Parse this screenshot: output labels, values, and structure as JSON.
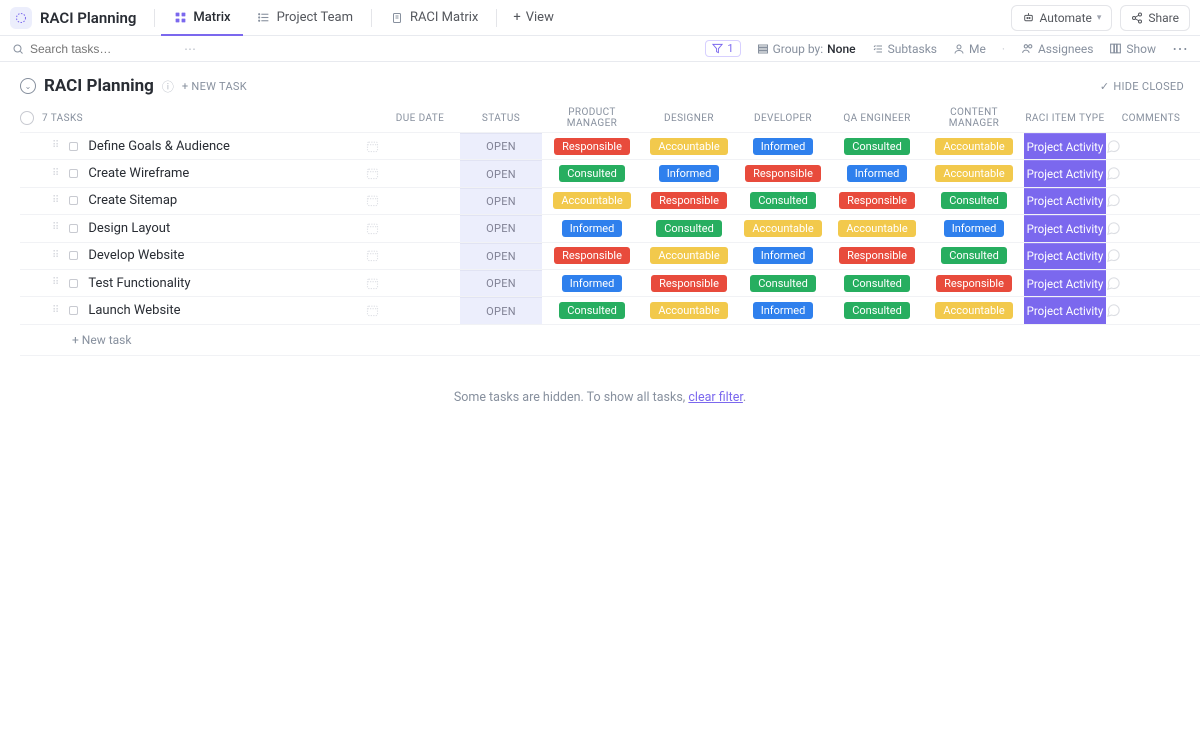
{
  "header": {
    "title": "RACI Planning",
    "tabs": [
      {
        "label": "Matrix",
        "active": true
      },
      {
        "label": "Project Team",
        "active": false
      },
      {
        "label": "RACI Matrix",
        "active": false
      }
    ],
    "view": "View",
    "automate": "Automate",
    "share": "Share"
  },
  "filterbar": {
    "search_placeholder": "Search tasks…",
    "filter_count": "1",
    "group_by_label": "Group by:",
    "group_by_value": "None",
    "subtasks": "Subtasks",
    "me": "Me",
    "assignees": "Assignees",
    "show": "Show"
  },
  "section": {
    "title": "RACI Planning",
    "new_task": "+ NEW TASK",
    "hide_closed": "HIDE CLOSED",
    "task_count_label": "7 TASKS"
  },
  "columns": {
    "due_date": "DUE DATE",
    "status": "STATUS",
    "product_manager": "PRODUCT MANAGER",
    "designer": "DESIGNER",
    "developer": "DEVELOPER",
    "qa_engineer": "QA ENGINEER",
    "content_manager": "CONTENT MANAGER",
    "raci_type": "RACI ITEM TYPE",
    "comments": "COMMENTS"
  },
  "raci_labels": {
    "responsible": "Responsible",
    "accountable": "Accountable",
    "consulted": "Consulted",
    "informed": "Informed"
  },
  "type_chip": "Project Activity",
  "status_open": "OPEN",
  "tasks": [
    {
      "name": "Define Goals & Audience",
      "pm": "responsible",
      "designer": "accountable",
      "developer": "informed",
      "qa": "consulted",
      "cm": "accountable"
    },
    {
      "name": "Create Wireframe",
      "pm": "consulted",
      "designer": "informed",
      "developer": "responsible",
      "qa": "informed",
      "cm": "accountable"
    },
    {
      "name": "Create Sitemap",
      "pm": "accountable",
      "designer": "responsible",
      "developer": "consulted",
      "qa": "responsible",
      "cm": "consulted"
    },
    {
      "name": "Design Layout",
      "pm": "informed",
      "designer": "consulted",
      "developer": "accountable",
      "qa": "accountable",
      "cm": "informed"
    },
    {
      "name": "Develop Website",
      "pm": "responsible",
      "designer": "accountable",
      "developer": "informed",
      "qa": "responsible",
      "cm": "consulted"
    },
    {
      "name": "Test Functionality",
      "pm": "informed",
      "designer": "responsible",
      "developer": "consulted",
      "qa": "consulted",
      "cm": "responsible"
    },
    {
      "name": "Launch Website",
      "pm": "consulted",
      "designer": "accountable",
      "developer": "informed",
      "qa": "consulted",
      "cm": "accountable"
    }
  ],
  "footer": {
    "add_task": "+ New task",
    "notice_prefix": "Some tasks are hidden. To show all tasks, ",
    "notice_link": "clear filter",
    "notice_suffix": "."
  }
}
